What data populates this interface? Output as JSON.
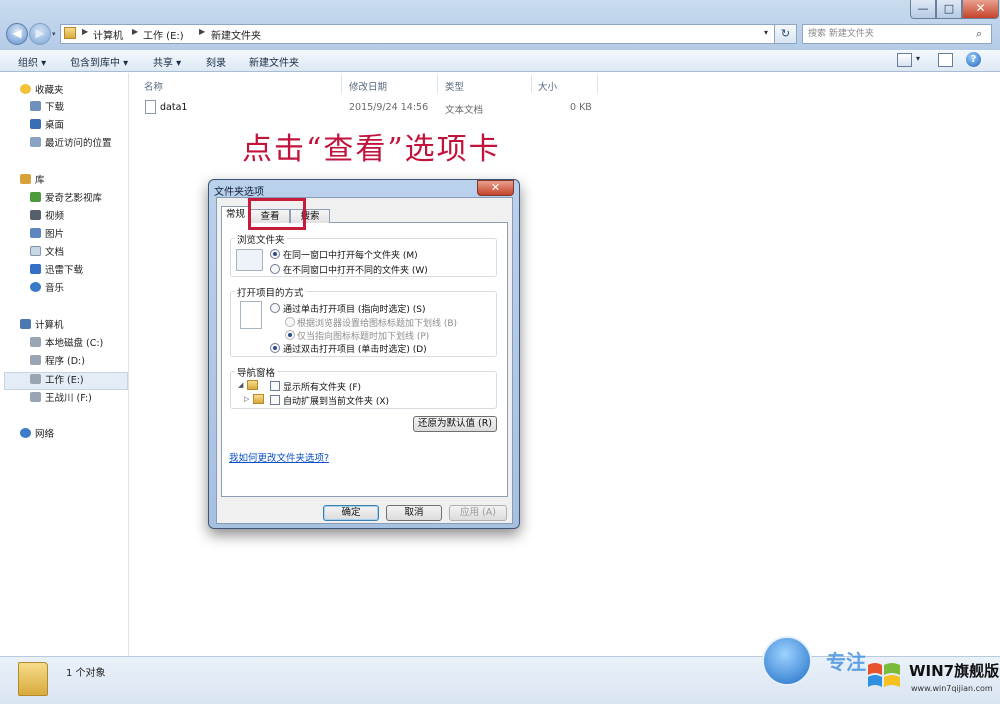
{
  "window": {
    "buttons": {
      "minimize": "—",
      "maximize": "□",
      "close": "✕"
    }
  },
  "address_bar": {
    "crumbs": [
      "计算机",
      "工作 (E:)",
      "新建文件夹"
    ],
    "search_placeholder": "搜索 新建文件夹"
  },
  "toolbar": {
    "items": [
      "组织 ▾",
      "包含到库中 ▾",
      "共享 ▾",
      "刻录",
      "新建文件夹"
    ]
  },
  "sidebar": {
    "favorites": {
      "label": "收藏夹",
      "items": [
        "下载",
        "桌面",
        "最近访问的位置"
      ]
    },
    "libraries": {
      "label": "库",
      "items": [
        "爱奇艺影视库",
        "视频",
        "图片",
        "文档",
        "迅雷下载",
        "音乐"
      ]
    },
    "computer": {
      "label": "计算机",
      "items": [
        "本地磁盘 (C:)",
        "程序 (D:)",
        "工作 (E:)",
        "王战川 (F:)"
      ]
    },
    "network": {
      "label": "网络"
    }
  },
  "file_list": {
    "columns": [
      "名称",
      "修改日期",
      "类型",
      "大小"
    ],
    "rows": [
      {
        "name": "data1",
        "modified": "2015/9/24 14:56",
        "type": "文本文档",
        "size": "0 KB"
      }
    ]
  },
  "instruction": "点击“查看”选项卡",
  "dialog": {
    "title": "文件夹选项",
    "close": "✕",
    "tabs": [
      "常规",
      "查看",
      "搜索"
    ],
    "browse_group": {
      "label": "浏览文件夹",
      "options": [
        "在同一窗口中打开每个文件夹 (M)",
        "在不同窗口中打开不同的文件夹 (W)"
      ]
    },
    "click_group": {
      "label": "打开项目的方式",
      "options": [
        "通过单击打开项目 (指向时选定) (S)",
        "根据浏览器设置给图标标题加下划线 (B)",
        "仅当指向图标标题时加下划线 (P)",
        "通过双击打开项目 (单击时选定) (D)"
      ]
    },
    "nav_group": {
      "label": "导航窗格",
      "options": [
        "显示所有文件夹 (F)",
        "自动扩展到当前文件夹 (X)"
      ]
    },
    "restore_button": "还原为默认值 (R)",
    "help_link": "我如何更改文件夹选项?",
    "buttons": {
      "ok": "确定",
      "cancel": "取消",
      "apply": "应用 (A)"
    }
  },
  "status_bar": {
    "text": "1 个对象"
  },
  "watermark": {
    "title": "WIN7旗舰版",
    "url": "www.win7qijian.com",
    "zh": "专注"
  }
}
